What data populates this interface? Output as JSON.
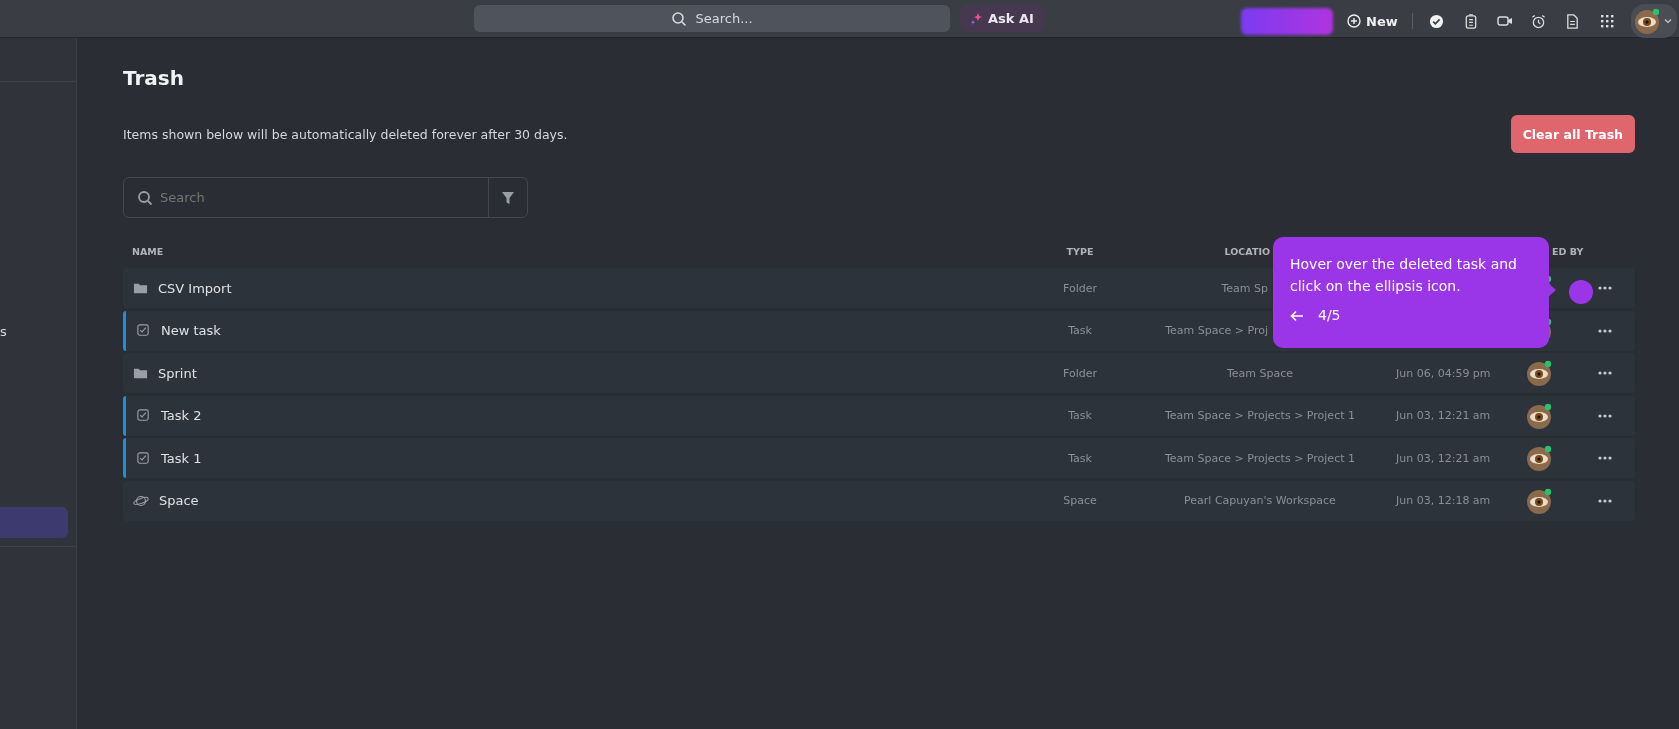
{
  "top_bar": {
    "search": {
      "placeholder": "Search..."
    },
    "ask_ai": "Ask AI",
    "new_button": "New"
  },
  "sidebar": {
    "fragment": "s",
    "items": [
      {
        "selected": true
      }
    ]
  },
  "page": {
    "title": "Trash",
    "description": "Items shown below will be automatically deleted forever after 30 days.",
    "clear_button": "Clear all Trash",
    "search": {
      "placeholder": "Search"
    }
  },
  "table": {
    "columns": [
      "NAME",
      "TYPE",
      "LOCATIO",
      "ED BY"
    ],
    "rows": [
      {
        "kind": "folder",
        "name": "CSV Import",
        "type": "Folder",
        "location": "Team Sp"
      },
      {
        "kind": "task",
        "name": "New task",
        "type": "Task",
        "location": "Team Space > Proj"
      },
      {
        "kind": "folder",
        "name": "Sprint",
        "type": "Folder",
        "location": "Team Space",
        "date": "Jun 06, 04:59 pm"
      },
      {
        "kind": "task",
        "name": "Task 2",
        "type": "Task",
        "location": "Team Space > Projects > Project 1",
        "date": "Jun 03, 12:21 am"
      },
      {
        "kind": "task",
        "name": "Task 1",
        "type": "Task",
        "location": "Team Space > Projects > Project 1",
        "date": "Jun 03, 12:21 am"
      },
      {
        "kind": "space",
        "name": "Space",
        "type": "Space",
        "location": "Pearl Capuyan's Workspace",
        "date": "Jun 03, 12:18 am"
      }
    ]
  },
  "tooltip": {
    "text": "Hover over the deleted task and click on the ellipsis icon.",
    "step": "4/5"
  }
}
